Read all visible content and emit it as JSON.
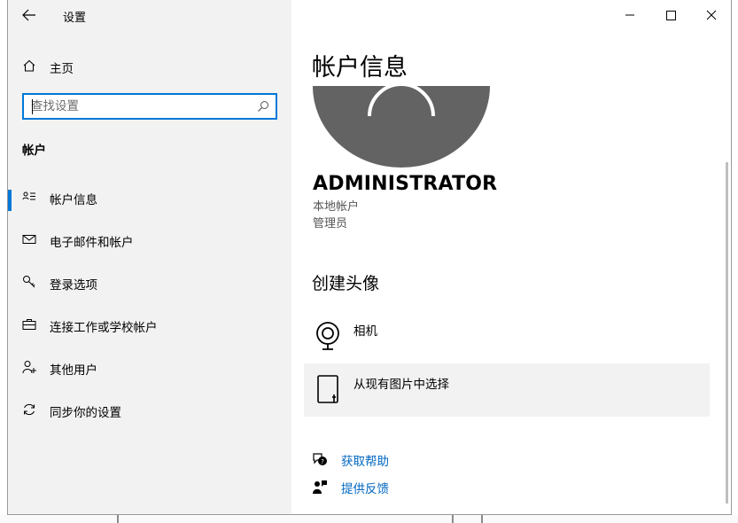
{
  "window": {
    "title": "设置",
    "controls": {
      "minimize": "minimize",
      "maximize": "maximize",
      "close": "close"
    }
  },
  "sidebar": {
    "home_label": "主页",
    "search": {
      "placeholder": "查找设置",
      "value": ""
    },
    "section_heading": "帐户",
    "items": [
      {
        "label": "帐户信息",
        "icon": "account-info-icon",
        "active": true
      },
      {
        "label": "电子邮件和帐户",
        "icon": "mail-icon",
        "active": false
      },
      {
        "label": "登录选项",
        "icon": "key-icon",
        "active": false
      },
      {
        "label": "连接工作或学校帐户",
        "icon": "briefcase-icon",
        "active": false
      },
      {
        "label": "其他用户",
        "icon": "add-person-icon",
        "active": false
      },
      {
        "label": "同步你的设置",
        "icon": "sync-icon",
        "active": false
      }
    ]
  },
  "main": {
    "title": "帐户信息",
    "user": {
      "name": "ADMINISTRATOR",
      "account_type": "本地帐户",
      "role": "管理员"
    },
    "create_avatar": {
      "heading": "创建头像",
      "options": [
        {
          "label": "相机",
          "icon": "camera-icon"
        },
        {
          "label": "从现有图片中选择",
          "icon": "browse-file-icon"
        }
      ]
    },
    "links": [
      {
        "label": "获取帮助",
        "icon": "help-chat-icon"
      },
      {
        "label": "提供反馈",
        "icon": "feedback-icon"
      }
    ]
  },
  "colors": {
    "accent": "#0078d7",
    "link": "#0067c0",
    "sidebar_bg": "#f2f2f2",
    "avatar_bg": "#636363"
  }
}
